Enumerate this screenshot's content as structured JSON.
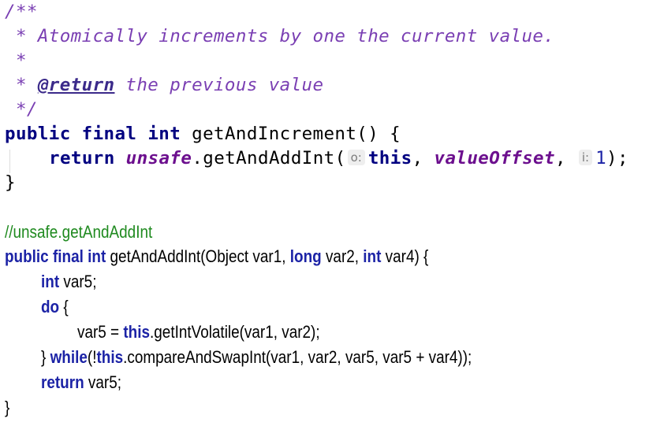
{
  "javadoc": {
    "open": "/**",
    "line1": " * Atomically increments by one the current value.",
    "line2": " *",
    "line3_prefix": " * ",
    "return_tag": "@return",
    "line3_text": " the previous value",
    "close": " */"
  },
  "method1": {
    "kw_public": "public",
    "kw_final": "final",
    "kw_int": "int",
    "signature": " getAndIncrement() {",
    "kw_return": "return",
    "unsafe_field": "unsafe",
    "call": ".getAndAddInt(",
    "hint_o": "o:",
    "kw_this": "this",
    "comma1": ", ",
    "value_offset": "valueOffset",
    "comma2": ", ",
    "hint_i": "i:",
    "arg_one": "1",
    "end_call": ");",
    "close_brace": "}"
  },
  "comment": "//unsafe.getAndAddInt",
  "method2": {
    "kw_public": "public",
    "kw_final": "final",
    "kw_int": "int",
    "sig_name": " getAndAddInt(Object var1, ",
    "kw_long": "long",
    "sig_mid": " var2, ",
    "kw_int2": "int",
    "sig_end": " var4) {",
    "decl_kw": "int",
    "decl_rest": " var5;",
    "do_kw": "do",
    "do_rest": " {",
    "assign_pre": "var5 = ",
    "assign_this": "this",
    "assign_rest": ".getIntVolatile(var1, var2);",
    "while_pre": "} ",
    "while_kw": "while",
    "while_paren": "(!",
    "while_this": "this",
    "while_rest": ".compareAndSwapInt(var1, var2, var5, var5 + var4));",
    "return_kw": "return",
    "return_rest": " var5;",
    "close_brace": "}"
  }
}
